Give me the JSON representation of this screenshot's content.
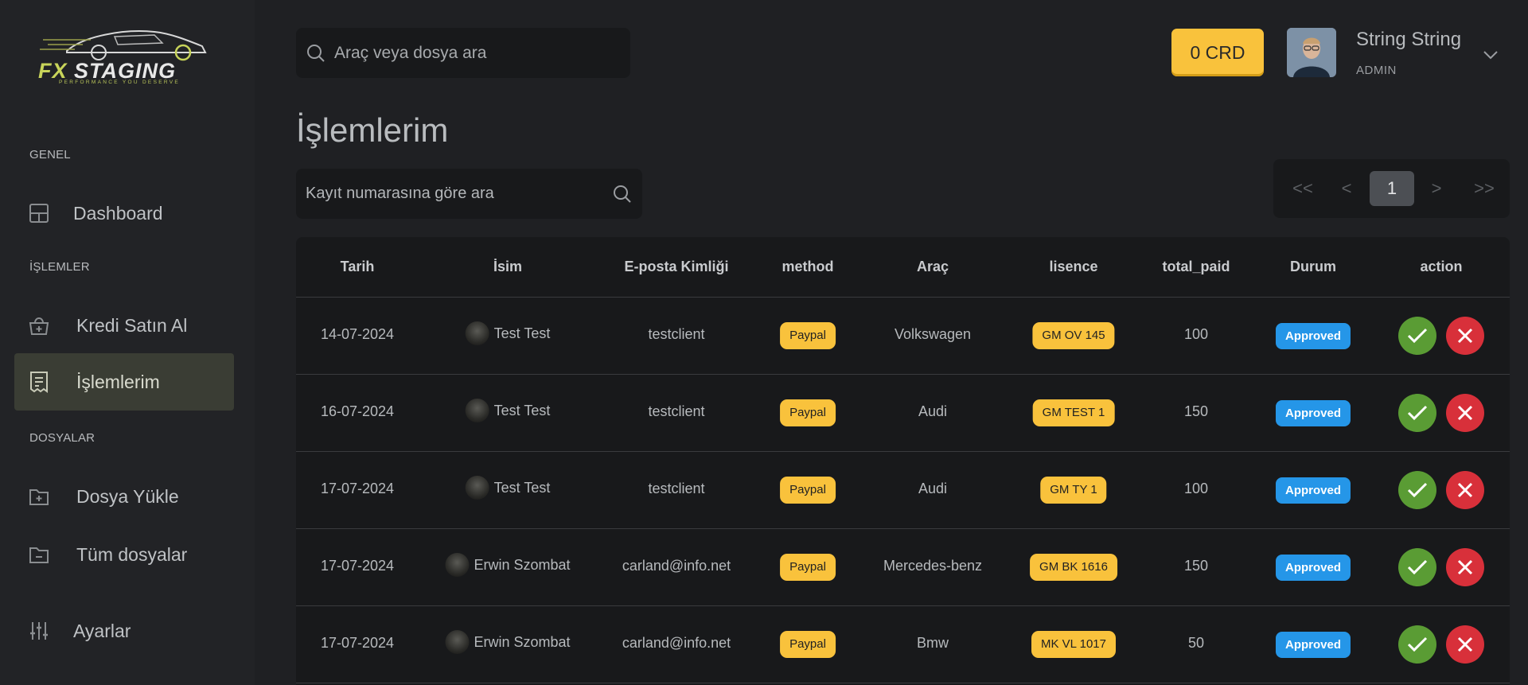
{
  "brand": {
    "logo_text_fx": "FX",
    "logo_text_rest": "STAGING",
    "tagline": "PERFORMANCE YOU DESERVE"
  },
  "sidebar": {
    "sections": [
      {
        "label": "GENEL"
      },
      {
        "label": "İŞLEMLER"
      },
      {
        "label": "DOSYALAR"
      }
    ],
    "items": [
      {
        "label": "Dashboard",
        "icon": "grid-icon"
      },
      {
        "label": "Kredi Satın Al",
        "icon": "bag-plus-icon"
      },
      {
        "label": "İşlemlerim",
        "icon": "receipt-icon",
        "active": true
      },
      {
        "label": "Dosya Yükle",
        "icon": "folder-plus-icon"
      },
      {
        "label": "Tüm dosyalar",
        "icon": "folder-minus-icon"
      },
      {
        "label": "Ayarlar",
        "icon": "sliders-icon"
      }
    ]
  },
  "header": {
    "search_placeholder": "Araç veya dosya ara",
    "credits": "0 CRD",
    "user_name": "String String",
    "user_role": "ADMIN"
  },
  "page": {
    "title": "İşlemlerim",
    "records_search_placeholder": "Kayıt numarasına göre ara",
    "pagination": {
      "first": "<<",
      "prev": "<",
      "current": "1",
      "next": ">",
      "last": ">>"
    }
  },
  "table": {
    "columns": [
      "Tarih",
      "İsim",
      "E-posta Kimliği",
      "method",
      "Araç",
      "lisence",
      "total_paid",
      "Durum",
      "action"
    ],
    "rows": [
      {
        "date": "14-07-2024",
        "name": "Test Test",
        "email": "testclient",
        "method": "Paypal",
        "vehicle": "Volkswagen",
        "license": "GM OV 145",
        "total": "100",
        "status": "Approved"
      },
      {
        "date": "16-07-2024",
        "name": "Test Test",
        "email": "testclient",
        "method": "Paypal",
        "vehicle": "Audi",
        "license": "GM TEST 1",
        "total": "150",
        "status": "Approved"
      },
      {
        "date": "17-07-2024",
        "name": "Test Test",
        "email": "testclient",
        "method": "Paypal",
        "vehicle": "Audi",
        "license": "GM TY 1",
        "total": "100",
        "status": "Approved"
      },
      {
        "date": "17-07-2024",
        "name": "Erwin Szombat",
        "email": "carland@info.net",
        "method": "Paypal",
        "vehicle": "Mercedes-benz",
        "license": "GM BK 1616",
        "total": "150",
        "status": "Approved"
      },
      {
        "date": "17-07-2024",
        "name": "Erwin Szombat",
        "email": "carland@info.net",
        "method": "Paypal",
        "vehicle": "Bmw",
        "license": "MK VL 1017",
        "total": "50",
        "status": "Approved"
      }
    ]
  },
  "colors": {
    "accent_yellow": "#f9c23c",
    "status_blue": "#2596e8",
    "approve_green": "#5a9c34",
    "reject_red": "#d8303a"
  }
}
